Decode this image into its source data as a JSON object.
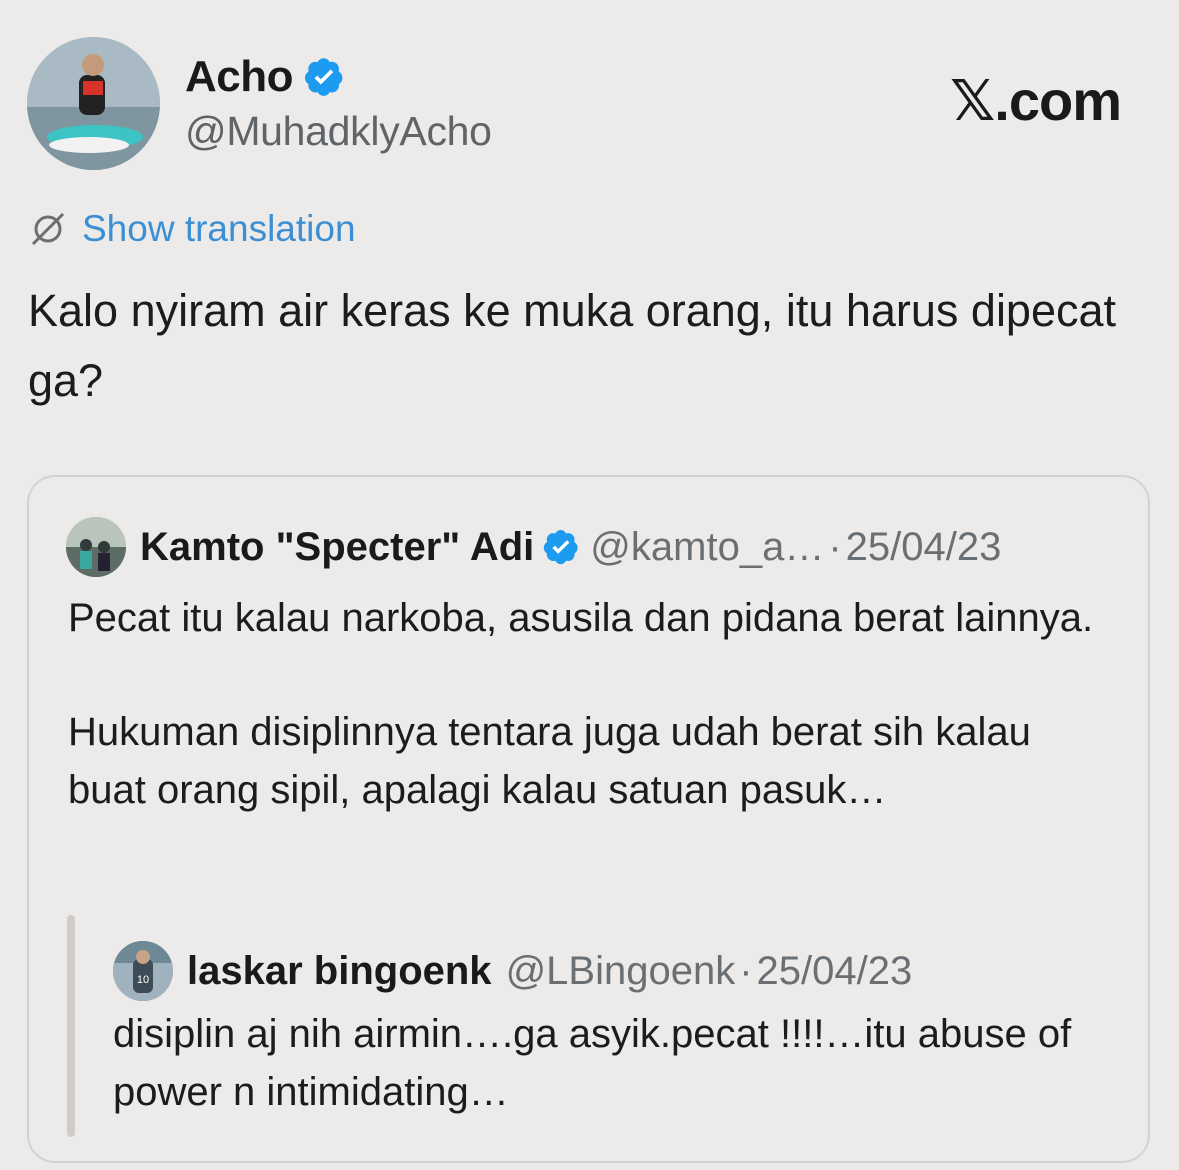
{
  "author": {
    "name": "Acho",
    "handle": "@MuhadklyAcho",
    "verified": true
  },
  "brand": "𝕏.com",
  "translate_label": "Show translation",
  "tweet_text": "Kalo nyiram air keras ke muka orang, itu harus dipecat ga?",
  "quote": {
    "name": "Kamto \"Specter\" Adi",
    "handle": "@kamto_a…",
    "separator": "·",
    "date": "25/04/23",
    "text_p1": "Pecat itu kalau narkoba, asusila dan pidana berat lainnya.",
    "text_p2": "Hukuman disiplinnya tentara juga udah berat sih kalau buat orang sipil, apalagi kalau satuan pasuk…"
  },
  "nested_quote": {
    "name": "laskar bingoenk",
    "handle": "@LBingoenk",
    "separator": "·",
    "date": "25/04/23",
    "text": "disiplin aj nih airmin….ga asyik.pecat !!!!…itu abuse of power n intimidating…"
  },
  "colors": {
    "background": "#edebea",
    "link": "#3d8fd3",
    "verified": "#1d9bf0",
    "secondary_text": "#5f6468"
  }
}
